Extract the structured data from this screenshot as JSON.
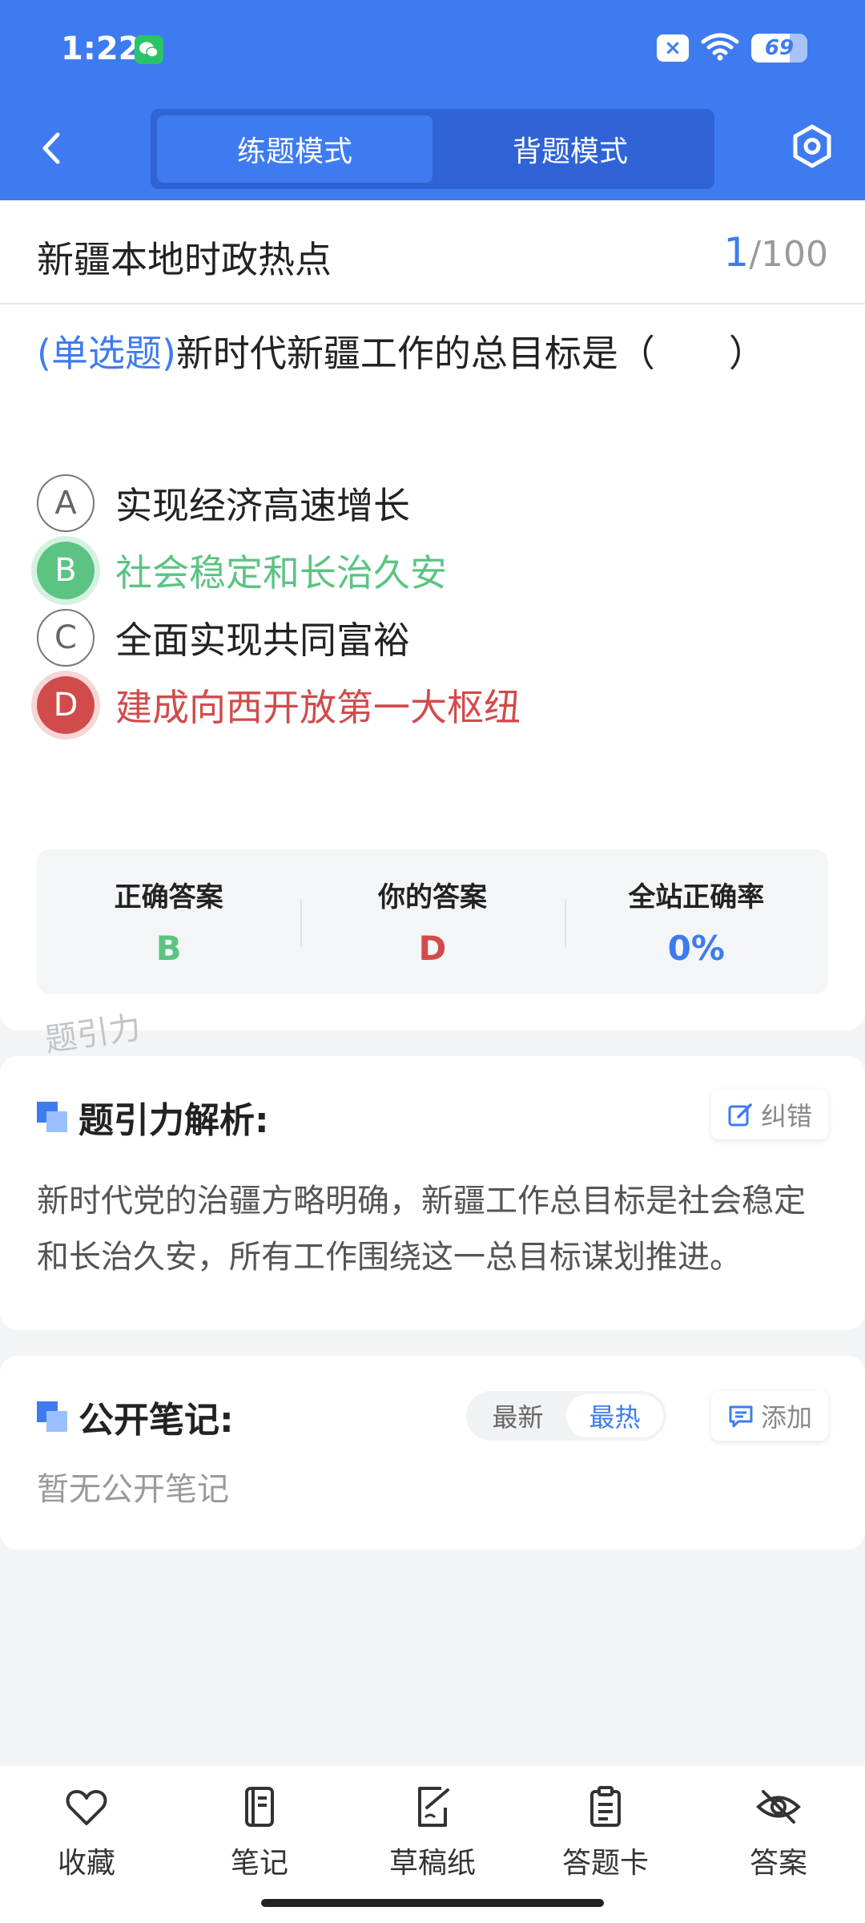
{
  "status_bar": {
    "time": "1:22",
    "battery": "69",
    "battery_level": 0.69,
    "icons": [
      "wechat-icon",
      "sim-blocked-icon",
      "wifi-icon",
      "battery-icon"
    ]
  },
  "header": {
    "modes": [
      {
        "label": "练题模式",
        "active": true
      },
      {
        "label": "背题模式",
        "active": false
      }
    ],
    "accent_color": "#3e7bf0"
  },
  "question": {
    "category": "新疆本地时政热点",
    "current": "1",
    "total": "/100",
    "type": "(单选题)",
    "text": "新时代新疆工作的总目标是（　　）",
    "options": [
      {
        "letter": "A",
        "text": "实现经济高速增长",
        "state": "default"
      },
      {
        "letter": "B",
        "text": "社会稳定和长治久安",
        "state": "correct"
      },
      {
        "letter": "C",
        "text": "全面实现共同富裕",
        "state": "default"
      },
      {
        "letter": "D",
        "text": "建成向西开放第一大枢纽",
        "state": "wrong"
      }
    ]
  },
  "stats": {
    "correct_label": "正确答案",
    "correct_value": "B",
    "yours_label": "你的答案",
    "yours_value": "D",
    "rate_label": "全站正确率",
    "rate_value": "0%"
  },
  "watermark": "题引力",
  "analysis": {
    "title": "题引力解析:",
    "report_label": "纠错",
    "text": "新时代党的治疆方略明确，新疆工作总目标是社会稳定和长治久安，所有工作围绕这一总目标谋划推进。"
  },
  "notes": {
    "title": "公开笔记:",
    "sort_options": [
      {
        "label": "最新",
        "active": false
      },
      {
        "label": "最热",
        "active": true
      }
    ],
    "add_label": "添加",
    "empty_text": "暂无公开笔记"
  },
  "bottom_nav": [
    {
      "label": "收藏",
      "icon": "heart-icon"
    },
    {
      "label": "笔记",
      "icon": "notebook-icon"
    },
    {
      "label": "草稿纸",
      "icon": "draft-paper-icon"
    },
    {
      "label": "答题卡",
      "icon": "answer-sheet-icon"
    },
    {
      "label": "答案",
      "icon": "eye-off-icon"
    }
  ]
}
